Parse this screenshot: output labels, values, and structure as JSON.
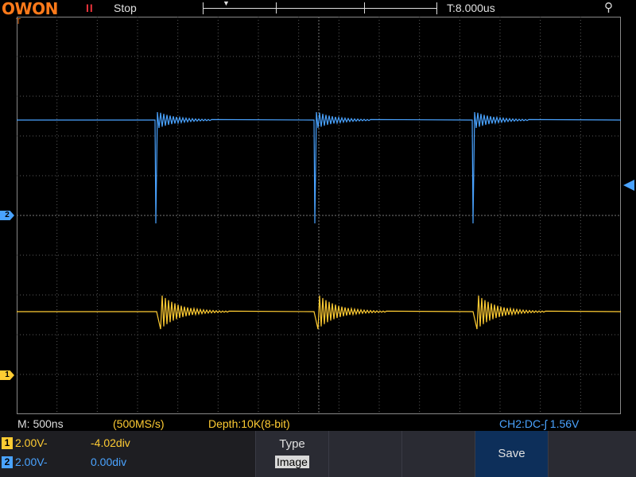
{
  "header": {
    "logo": "OWON",
    "run_state_icon": "II",
    "run_state": "Stop",
    "trigger_time": "T:8.000us",
    "usb_icon": "usb-icon"
  },
  "markers": {
    "ch1": "1",
    "ch2": "2",
    "trigger_position": "T"
  },
  "status": {
    "timebase": "M: 500ns",
    "sample_rate": "(500MS/s)",
    "depth": "Depth:10K(8-bit)",
    "trigger": "CH2:DC-ʃ  1.56V"
  },
  "channels": [
    {
      "num": "1",
      "scale": "2.00V-",
      "offset": "-4.02div"
    },
    {
      "num": "2",
      "scale": "2.00V-",
      "offset": "0.00div"
    }
  ],
  "menu": {
    "type_title": "Type",
    "type_value": "Image",
    "save_label": "Save"
  },
  "colors": {
    "ch1": "#ffcc33",
    "ch2": "#4aa3ff",
    "grid": "#5a5a5a",
    "brand": "#ff7a1a"
  }
}
